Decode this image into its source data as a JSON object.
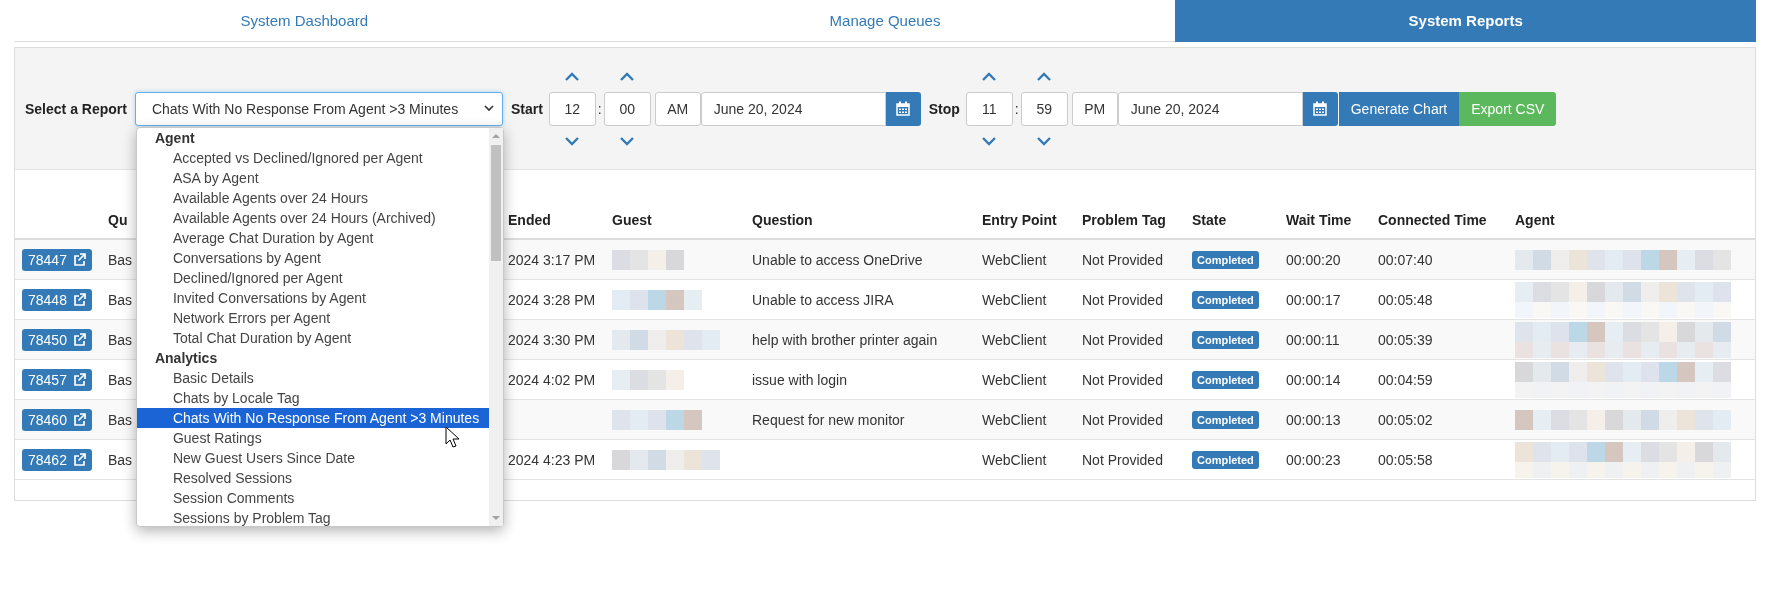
{
  "tabs": [
    {
      "label": "System Dashboard",
      "selected": false
    },
    {
      "label": "Manage Queues",
      "selected": false
    },
    {
      "label": "System Reports",
      "selected": true
    }
  ],
  "report_form": {
    "label": "Select a Report",
    "select": {
      "value": "Chats With No Response From Agent >3 Minutes",
      "expanded": true
    },
    "start": {
      "label": "Start",
      "hour": "12",
      "separator": ":",
      "minute": "00",
      "meridiem": "AM",
      "date": "June 20, 2024"
    },
    "stop": {
      "label": "Stop",
      "hour": "11",
      "separator": ":",
      "minute": "59",
      "meridiem": "PM",
      "date": "June 20, 2024"
    },
    "buttons": [
      {
        "label": "Generate Chart",
        "kind": "primary"
      },
      {
        "label": "Export CSV",
        "kind": "success"
      }
    ]
  },
  "dropdown": {
    "groups": [
      {
        "label": "Agent",
        "options": [
          {
            "label": "Accepted vs Declined/Ignored per Agent",
            "selected": false
          },
          {
            "label": "ASA by Agent",
            "selected": false
          },
          {
            "label": "Available Agents over 24 Hours",
            "selected": false
          },
          {
            "label": "Available Agents over 24 Hours (Archived)",
            "selected": false
          },
          {
            "label": "Average Chat Duration by Agent",
            "selected": false
          },
          {
            "label": "Conversations by Agent",
            "selected": false
          },
          {
            "label": "Declined/Ignored per Agent",
            "selected": false
          },
          {
            "label": "Invited Conversations by Agent",
            "selected": false
          },
          {
            "label": "Network Errors per Agent",
            "selected": false
          },
          {
            "label": "Total Chat Duration by Agent",
            "selected": false
          }
        ]
      },
      {
        "label": "Analytics",
        "options": [
          {
            "label": "Basic Details",
            "selected": false
          },
          {
            "label": "Chats by Locale Tag",
            "selected": false
          },
          {
            "label": "Chats With No Response From Agent >3 Minutes",
            "selected": true
          },
          {
            "label": "Guest Ratings",
            "selected": false
          },
          {
            "label": "New Guest Users Since Date",
            "selected": false
          },
          {
            "label": "Resolved Sessions",
            "selected": false
          },
          {
            "label": "Session Comments",
            "selected": false
          },
          {
            "label": "Sessions by Problem Tag",
            "selected": false
          }
        ]
      }
    ]
  },
  "table": {
    "columns": [
      "Qu",
      "Ended",
      "Guest",
      "Question",
      "Entry Point",
      "Problem Tag",
      "State",
      "Wait Time",
      "Connected Time",
      "Agent"
    ],
    "rows": [
      {
        "id": "78447",
        "column_2": "Bas",
        "ended": "2024 3:17 PM",
        "question": "Unable to access OneDrive",
        "entry_point": "WebClient",
        "problem_tag": "Not Provided",
        "state": "Completed",
        "wait_time": "00:00:20",
        "connected_time": "00:07:40"
      },
      {
        "id": "78448",
        "column_2": "Bas",
        "ended": "2024 3:28 PM",
        "question": "Unable to access JIRA",
        "entry_point": "WebClient",
        "problem_tag": "Not Provided",
        "state": "Completed",
        "wait_time": "00:00:17",
        "connected_time": "00:05:48"
      },
      {
        "id": "78450",
        "column_2": "Bas",
        "ended": "2024 3:30 PM",
        "question": "help with brother printer again",
        "entry_point": "WebClient",
        "problem_tag": "Not Provided",
        "state": "Completed",
        "wait_time": "00:00:11",
        "connected_time": "00:05:39"
      },
      {
        "id": "78457",
        "column_2": "Bas",
        "ended": "2024 4:02 PM",
        "question": "issue with login",
        "entry_point": "WebClient",
        "problem_tag": "Not Provided",
        "state": "Completed",
        "wait_time": "00:00:14",
        "connected_time": "00:04:59"
      },
      {
        "id": "78460",
        "column_2": "Bas",
        "question": "Request for new monitor",
        "entry_point": "WebClient",
        "problem_tag": "Not Provided",
        "state": "Completed",
        "wait_time": "00:00:13",
        "connected_time": "00:05:02"
      },
      {
        "id": "78462",
        "column_2": "Bas",
        "ended": "2024 4:23 PM",
        "entry_point": "WebClient",
        "problem_tag": "Not Provided",
        "state": "Completed",
        "wait_time": "00:00:23",
        "connected_time": "00:05:58"
      }
    ]
  }
}
